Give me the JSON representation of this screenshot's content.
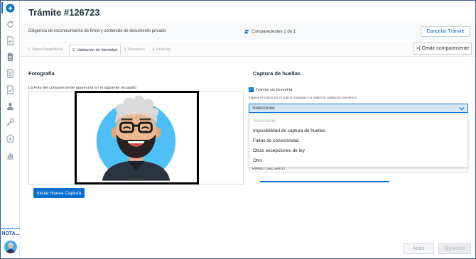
{
  "header": {
    "title": "Trámite #126723",
    "description": "Diligencia de reconocimiento de firma y contenido de documento privado",
    "comparecientes": "Comparecientes 1 de 1",
    "cancel_label": "Cancelar Trámite"
  },
  "tabs": [
    {
      "label": "1. Datos Biográficos",
      "active": false
    },
    {
      "label": "2. Validación de Identidad",
      "active": true
    },
    {
      "label": "3. Resumen",
      "active": false
    },
    {
      "label": "4. Preacta",
      "active": false
    }
  ],
  "omitir_label": ">| Omitir compareciente",
  "foto": {
    "title": "Fotografía",
    "caption": "La Foto del compareciente aparecerá en el siguiente recuadro",
    "capture_label": "Iniciar Nueva Captura"
  },
  "huellas": {
    "title": "Captura de huellas",
    "checkbox_label": "Trámite sin biometría",
    "hint": "Ingrese el motivo por el cual el ciudadano no realiza la validación biométrica",
    "select_value": "Seleccione",
    "options": [
      "Seleccione",
      "Imposibilidad de captura de huellas",
      "Fallas de conectividad",
      "Otras excepciones de ley",
      "Otro"
    ],
    "below_value": "RIANO DELGADO"
  },
  "sidebar": {
    "nota_label": "NOTA..."
  },
  "footer": {
    "back_label": "Atrás",
    "next_label": "Siguiente"
  },
  "colors": {
    "accent": "#0a6ed1",
    "avatar_bg": "#4ec0f5"
  }
}
